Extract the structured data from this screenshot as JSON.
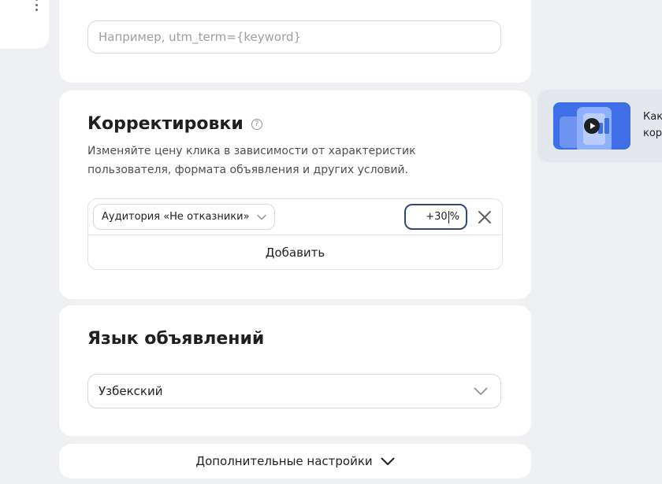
{
  "url_params": {
    "placeholder": "Например, utm_term={keyword}"
  },
  "adjustments": {
    "title": "Корректировки",
    "help": "?",
    "description": "Изменяйте цену клика в зависимости от характеристик пользователя, формата объявления и других условий.",
    "items": [
      {
        "audience_label": "Аудитория «Не отказники»",
        "value_before_caret": "+30",
        "value_after_caret": "%"
      }
    ],
    "add_label": "Добавить"
  },
  "language": {
    "title": "Язык объявлений",
    "selected": "Узбекский"
  },
  "more": {
    "label": "Дополнительные настройки"
  },
  "promo": {
    "line1": "Как",
    "line2": "кор"
  },
  "colors": {
    "background": "#eef0f4",
    "card": "#ffffff",
    "focus_border": "#2e4a7d",
    "promo_blue": "#3f6fe6"
  },
  "icons": {
    "help": "question-circle-icon",
    "chevron": "chevron-down-icon",
    "close": "close-icon",
    "menu": "kebab-menu-icon",
    "play": "play-icon"
  }
}
